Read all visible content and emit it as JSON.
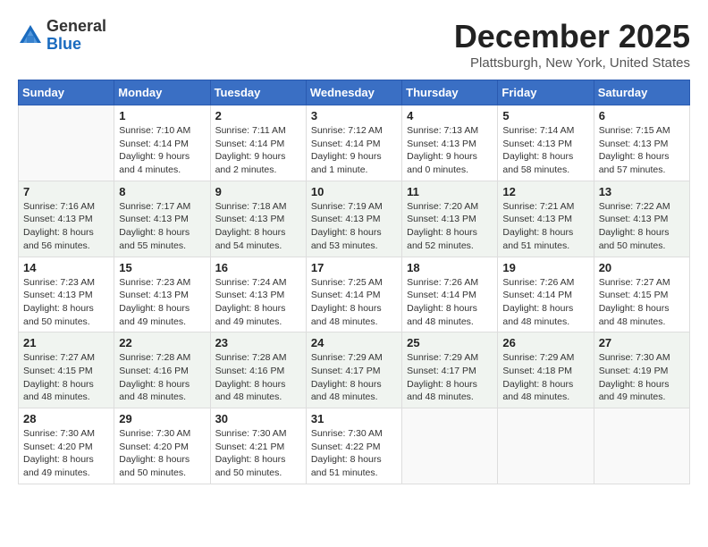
{
  "logo": {
    "general": "General",
    "blue": "Blue"
  },
  "header": {
    "month": "December 2025",
    "location": "Plattsburgh, New York, United States"
  },
  "weekdays": [
    "Sunday",
    "Monday",
    "Tuesday",
    "Wednesday",
    "Thursday",
    "Friday",
    "Saturday"
  ],
  "weeks": [
    [
      {
        "day": "",
        "info": ""
      },
      {
        "day": "1",
        "info": "Sunrise: 7:10 AM\nSunset: 4:14 PM\nDaylight: 9 hours\nand 4 minutes."
      },
      {
        "day": "2",
        "info": "Sunrise: 7:11 AM\nSunset: 4:14 PM\nDaylight: 9 hours\nand 2 minutes."
      },
      {
        "day": "3",
        "info": "Sunrise: 7:12 AM\nSunset: 4:14 PM\nDaylight: 9 hours\nand 1 minute."
      },
      {
        "day": "4",
        "info": "Sunrise: 7:13 AM\nSunset: 4:13 PM\nDaylight: 9 hours\nand 0 minutes."
      },
      {
        "day": "5",
        "info": "Sunrise: 7:14 AM\nSunset: 4:13 PM\nDaylight: 8 hours\nand 58 minutes."
      },
      {
        "day": "6",
        "info": "Sunrise: 7:15 AM\nSunset: 4:13 PM\nDaylight: 8 hours\nand 57 minutes."
      }
    ],
    [
      {
        "day": "7",
        "info": "Sunrise: 7:16 AM\nSunset: 4:13 PM\nDaylight: 8 hours\nand 56 minutes."
      },
      {
        "day": "8",
        "info": "Sunrise: 7:17 AM\nSunset: 4:13 PM\nDaylight: 8 hours\nand 55 minutes."
      },
      {
        "day": "9",
        "info": "Sunrise: 7:18 AM\nSunset: 4:13 PM\nDaylight: 8 hours\nand 54 minutes."
      },
      {
        "day": "10",
        "info": "Sunrise: 7:19 AM\nSunset: 4:13 PM\nDaylight: 8 hours\nand 53 minutes."
      },
      {
        "day": "11",
        "info": "Sunrise: 7:20 AM\nSunset: 4:13 PM\nDaylight: 8 hours\nand 52 minutes."
      },
      {
        "day": "12",
        "info": "Sunrise: 7:21 AM\nSunset: 4:13 PM\nDaylight: 8 hours\nand 51 minutes."
      },
      {
        "day": "13",
        "info": "Sunrise: 7:22 AM\nSunset: 4:13 PM\nDaylight: 8 hours\nand 50 minutes."
      }
    ],
    [
      {
        "day": "14",
        "info": "Sunrise: 7:23 AM\nSunset: 4:13 PM\nDaylight: 8 hours\nand 50 minutes."
      },
      {
        "day": "15",
        "info": "Sunrise: 7:23 AM\nSunset: 4:13 PM\nDaylight: 8 hours\nand 49 minutes."
      },
      {
        "day": "16",
        "info": "Sunrise: 7:24 AM\nSunset: 4:13 PM\nDaylight: 8 hours\nand 49 minutes."
      },
      {
        "day": "17",
        "info": "Sunrise: 7:25 AM\nSunset: 4:14 PM\nDaylight: 8 hours\nand 48 minutes."
      },
      {
        "day": "18",
        "info": "Sunrise: 7:26 AM\nSunset: 4:14 PM\nDaylight: 8 hours\nand 48 minutes."
      },
      {
        "day": "19",
        "info": "Sunrise: 7:26 AM\nSunset: 4:14 PM\nDaylight: 8 hours\nand 48 minutes."
      },
      {
        "day": "20",
        "info": "Sunrise: 7:27 AM\nSunset: 4:15 PM\nDaylight: 8 hours\nand 48 minutes."
      }
    ],
    [
      {
        "day": "21",
        "info": "Sunrise: 7:27 AM\nSunset: 4:15 PM\nDaylight: 8 hours\nand 48 minutes."
      },
      {
        "day": "22",
        "info": "Sunrise: 7:28 AM\nSunset: 4:16 PM\nDaylight: 8 hours\nand 48 minutes."
      },
      {
        "day": "23",
        "info": "Sunrise: 7:28 AM\nSunset: 4:16 PM\nDaylight: 8 hours\nand 48 minutes."
      },
      {
        "day": "24",
        "info": "Sunrise: 7:29 AM\nSunset: 4:17 PM\nDaylight: 8 hours\nand 48 minutes."
      },
      {
        "day": "25",
        "info": "Sunrise: 7:29 AM\nSunset: 4:17 PM\nDaylight: 8 hours\nand 48 minutes."
      },
      {
        "day": "26",
        "info": "Sunrise: 7:29 AM\nSunset: 4:18 PM\nDaylight: 8 hours\nand 48 minutes."
      },
      {
        "day": "27",
        "info": "Sunrise: 7:30 AM\nSunset: 4:19 PM\nDaylight: 8 hours\nand 49 minutes."
      }
    ],
    [
      {
        "day": "28",
        "info": "Sunrise: 7:30 AM\nSunset: 4:20 PM\nDaylight: 8 hours\nand 49 minutes."
      },
      {
        "day": "29",
        "info": "Sunrise: 7:30 AM\nSunset: 4:20 PM\nDaylight: 8 hours\nand 50 minutes."
      },
      {
        "day": "30",
        "info": "Sunrise: 7:30 AM\nSunset: 4:21 PM\nDaylight: 8 hours\nand 50 minutes."
      },
      {
        "day": "31",
        "info": "Sunrise: 7:30 AM\nSunset: 4:22 PM\nDaylight: 8 hours\nand 51 minutes."
      },
      {
        "day": "",
        "info": ""
      },
      {
        "day": "",
        "info": ""
      },
      {
        "day": "",
        "info": ""
      }
    ]
  ]
}
